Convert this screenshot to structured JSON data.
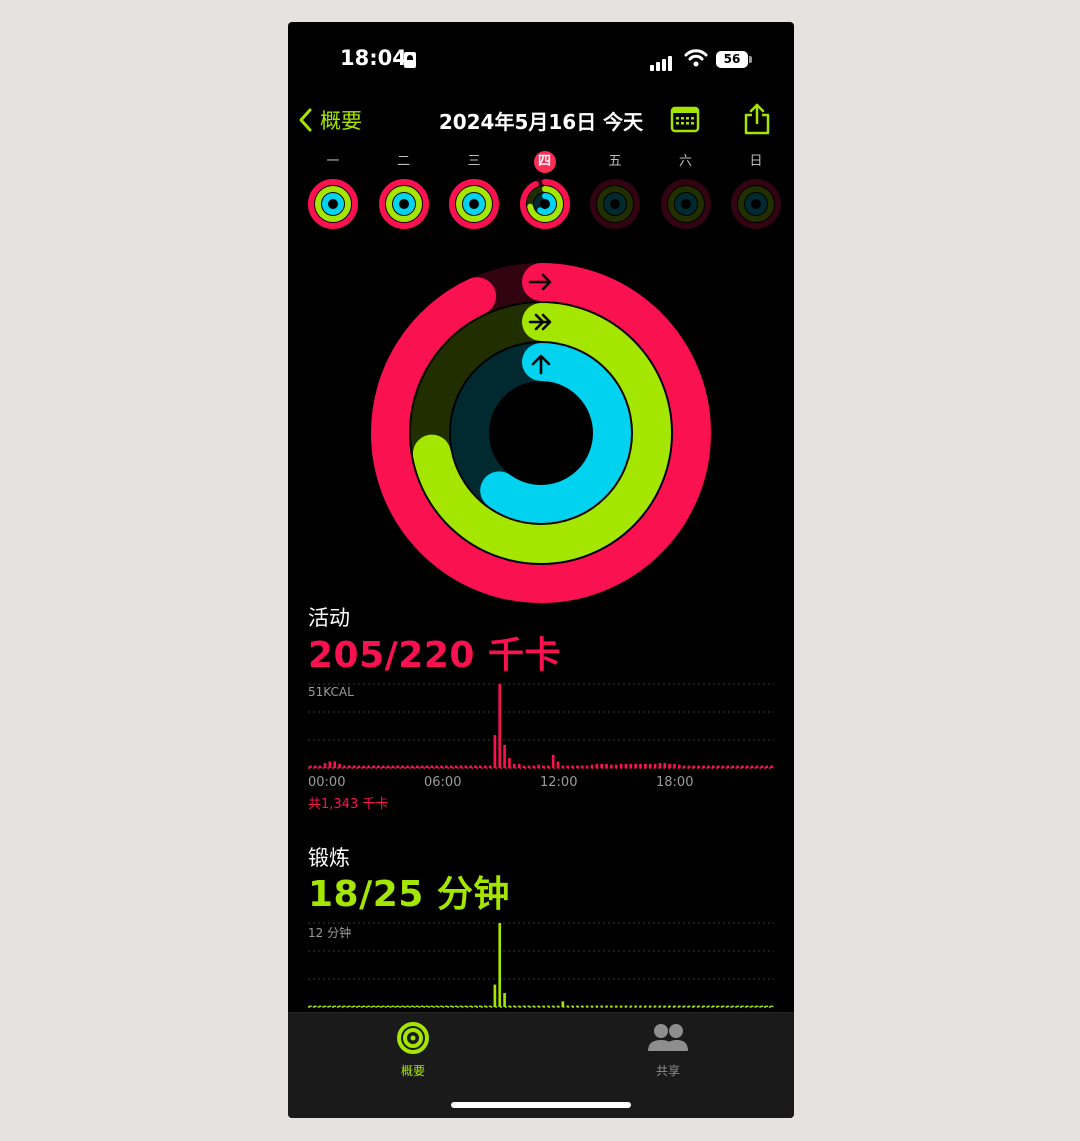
{
  "status": {
    "time": "18:04",
    "battery": "56"
  },
  "nav": {
    "back_label": "概要",
    "title": "2024年5月16日 今天"
  },
  "week": {
    "days": [
      "一",
      "二",
      "三",
      "四",
      "五",
      "六",
      "日"
    ],
    "today_index": 3,
    "rings": [
      {
        "move": 1.0,
        "exercise": 1.0,
        "stand": 1.0
      },
      {
        "move": 1.0,
        "exercise": 1.0,
        "stand": 1.0
      },
      {
        "move": 1.0,
        "exercise": 1.0,
        "stand": 1.0
      },
      {
        "move": 0.93,
        "exercise": 0.72,
        "stand": 0.6
      },
      {
        "move": 0,
        "exercise": 0,
        "stand": 0
      },
      {
        "move": 0,
        "exercise": 0,
        "stand": 0
      },
      {
        "move": 0,
        "exercise": 0,
        "stand": 0
      }
    ]
  },
  "rings": {
    "move": 0.93,
    "exercise": 0.72,
    "stand": 0.6
  },
  "colors": {
    "move": "#fa114f",
    "exercise": "#a4e600",
    "stand": "#00d2f0",
    "accent": "#a4e600"
  },
  "move": {
    "label": "活动",
    "value": "205/220 千卡",
    "axis_max": "51KCAL",
    "x_ticks": [
      "00:00",
      "06:00",
      "12:00",
      "18:00"
    ],
    "total": "共1,343 千卡"
  },
  "exercise": {
    "label": "锻炼",
    "value": "18/25 分钟",
    "axis_max": "12 分钟"
  },
  "chart_data": [
    {
      "type": "bar",
      "x": [
        0,
        1,
        2,
        3,
        4,
        5,
        6,
        7,
        8,
        9,
        10,
        11,
        12,
        13,
        14,
        15,
        16,
        17,
        18,
        19,
        20,
        21,
        22,
        23,
        24,
        25,
        26,
        27,
        28,
        29,
        30,
        31,
        32,
        33,
        34,
        35,
        36,
        37,
        38,
        39,
        40,
        41,
        42,
        43,
        44,
        45,
        46,
        47,
        48,
        49,
        50,
        51,
        52,
        53,
        54,
        55,
        56,
        57,
        58,
        59,
        60,
        61,
        62,
        63,
        64,
        65,
        66,
        67,
        68,
        69,
        70,
        71,
        72,
        73,
        74,
        75,
        76,
        77,
        78,
        79,
        80,
        81,
        82,
        83,
        84,
        85,
        86,
        87,
        88,
        89,
        90,
        91,
        92,
        93,
        94,
        95
      ],
      "values": [
        1.5,
        1.5,
        1.5,
        3,
        4,
        4,
        2.5,
        1.5,
        1.5,
        1.5,
        1.5,
        1.5,
        1.5,
        1.5,
        1.5,
        1.5,
        1.5,
        1.5,
        1.5,
        1.5,
        1.5,
        1.5,
        1.5,
        1.5,
        1.5,
        1.5,
        1.5,
        1.5,
        1.5,
        1.5,
        1.5,
        1.5,
        1.5,
        1.5,
        1.5,
        1.5,
        1.5,
        1.5,
        20,
        51,
        14,
        6,
        2.5,
        2.5,
        1.5,
        1.5,
        1.5,
        2,
        1.5,
        1.5,
        8,
        4,
        1.5,
        1.5,
        1.5,
        1.5,
        1.5,
        1.5,
        2,
        2.5,
        2.5,
        2.5,
        2,
        2,
        2.5,
        2.5,
        2.5,
        2.5,
        2.5,
        2.5,
        2.5,
        2.5,
        3,
        3,
        2.5,
        2.5,
        2,
        1.5,
        1.5,
        1.5,
        1.5,
        1.5,
        1.5,
        1.5,
        1.5,
        1.5,
        1.5,
        1.5,
        1.5,
        1.5,
        1.5,
        1.5,
        1.5,
        1.5,
        1.5,
        1.5
      ],
      "ylabel": "51KCAL",
      "ylim": [
        0,
        51
      ],
      "x_tick_labels": [
        "00:00",
        "06:00",
        "12:00",
        "18:00"
      ],
      "color": "#fa114f"
    },
    {
      "type": "bar",
      "x": [
        0,
        1,
        2,
        3,
        4,
        5,
        6,
        7,
        8,
        9,
        10,
        11,
        12,
        13,
        14,
        15,
        16,
        17,
        18,
        19,
        20,
        21,
        22,
        23,
        24,
        25,
        26,
        27,
        28,
        29,
        30,
        31,
        32,
        33,
        34,
        35,
        36,
        37,
        38,
        39,
        40,
        41,
        42,
        43,
        44,
        45,
        46,
        47,
        48,
        49,
        50,
        51,
        52,
        53,
        54,
        55,
        56,
        57,
        58,
        59,
        60,
        61,
        62,
        63,
        64,
        65,
        66,
        67,
        68,
        69,
        70,
        71,
        72,
        73,
        74,
        75,
        76,
        77,
        78,
        79,
        80,
        81,
        82,
        83,
        84,
        85,
        86,
        87,
        88,
        89,
        90,
        91,
        92,
        93,
        94,
        95
      ],
      "values": [
        0.2,
        0.2,
        0.2,
        0.2,
        0.2,
        0.2,
        0.2,
        0.2,
        0.2,
        0.2,
        0.2,
        0.2,
        0.2,
        0.2,
        0.2,
        0.2,
        0.2,
        0.2,
        0.2,
        0.2,
        0.2,
        0.2,
        0.2,
        0.2,
        0.2,
        0.2,
        0.2,
        0.2,
        0.2,
        0.2,
        0.2,
        0.2,
        0.2,
        0.2,
        0.2,
        0.2,
        0.2,
        0.2,
        3.2,
        12,
        2,
        0.2,
        0.2,
        0.2,
        0.2,
        0.2,
        0.2,
        0.2,
        0.2,
        0.2,
        0.2,
        0.2,
        0.8,
        0.2,
        0.2,
        0.2,
        0.2,
        0.2,
        0.2,
        0.2,
        0.2,
        0.2,
        0.2,
        0.2,
        0.2,
        0.2,
        0.2,
        0.2,
        0.2,
        0.2,
        0.2,
        0.2,
        0.2,
        0.2,
        0.2,
        0.2,
        0.2,
        0.2,
        0.2,
        0.2,
        0.2,
        0.2,
        0.2,
        0.2,
        0.2,
        0.2,
        0.2,
        0.2,
        0.2,
        0.2,
        0.2,
        0.2,
        0.2,
        0.2,
        0.2,
        0.2
      ],
      "ylabel": "12 分钟",
      "ylim": [
        0,
        12
      ],
      "color": "#a4e600"
    }
  ],
  "tabs": [
    {
      "label": "概要",
      "active": true
    },
    {
      "label": "共享",
      "active": false
    }
  ]
}
